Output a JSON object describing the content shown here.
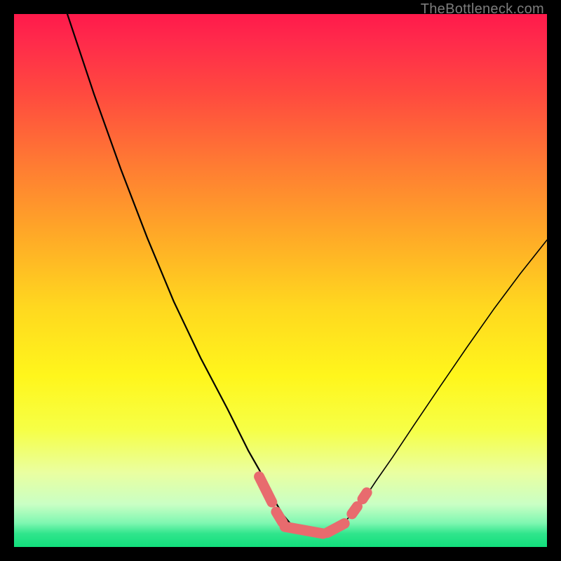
{
  "watermark": "TheBottleneck.com",
  "chart_data": {
    "type": "line",
    "title": "",
    "xlabel": "",
    "ylabel": "",
    "xlim": [
      0,
      100
    ],
    "ylim": [
      0,
      100
    ],
    "grid": false,
    "background_gradient": {
      "stops": [
        {
          "pos": 0.0,
          "color": "#ff1a4b"
        },
        {
          "pos": 0.05,
          "color": "#ff2a4b"
        },
        {
          "pos": 0.15,
          "color": "#ff4a3f"
        },
        {
          "pos": 0.28,
          "color": "#ff7a33"
        },
        {
          "pos": 0.4,
          "color": "#ffa428"
        },
        {
          "pos": 0.55,
          "color": "#ffd81f"
        },
        {
          "pos": 0.68,
          "color": "#fff61c"
        },
        {
          "pos": 0.78,
          "color": "#f6ff46"
        },
        {
          "pos": 0.86,
          "color": "#eaffa0"
        },
        {
          "pos": 0.92,
          "color": "#c9ffc4"
        },
        {
          "pos": 0.955,
          "color": "#7ff7b1"
        },
        {
          "pos": 0.975,
          "color": "#30e58c"
        },
        {
          "pos": 1.0,
          "color": "#12df7c"
        }
      ]
    },
    "series": [
      {
        "name": "left-branch",
        "stroke": "#000000",
        "x": [
          10,
          15,
          20,
          25,
          30,
          35,
          40,
          44,
          46,
          47.5,
          49,
          50.5,
          52,
          53,
          54,
          55
        ],
        "y": [
          100,
          85,
          71,
          58,
          46,
          35.5,
          26,
          18,
          14.5,
          11.5,
          8.5,
          6,
          4.2,
          3.3,
          2.8,
          2.5
        ]
      },
      {
        "name": "right-branch",
        "stroke": "#000000",
        "x": [
          55,
          57,
          59,
          61,
          62.5,
          64,
          66,
          68,
          71,
          75,
          80,
          85,
          90,
          95,
          100
        ],
        "y": [
          2.5,
          2.6,
          3.1,
          4.0,
          5.2,
          6.9,
          9.5,
          12.5,
          16.8,
          22.8,
          30.2,
          37.5,
          44.6,
          51.3,
          57.6
        ]
      },
      {
        "name": "floor-band",
        "stroke": "#000000",
        "x": [
          46,
          65
        ],
        "y": [
          2.4,
          2.4
        ]
      }
    ],
    "markers": [
      {
        "name": "marker-region",
        "shape": "pill",
        "color": "#e86b6e",
        "segments": [
          {
            "x1": 46.0,
            "y1": 13.2,
            "x2": 48.4,
            "y2": 8.4
          },
          {
            "x1": 49.2,
            "y1": 6.6,
            "x2": 50.4,
            "y2": 4.6
          },
          {
            "x1": 50.8,
            "y1": 3.8,
            "x2": 58.0,
            "y2": 2.5
          },
          {
            "x1": 58.8,
            "y1": 2.7,
            "x2": 62.0,
            "y2": 4.4
          },
          {
            "x1": 63.4,
            "y1": 6.2,
            "x2": 64.4,
            "y2": 7.6
          },
          {
            "x1": 65.4,
            "y1": 9.0,
            "x2": 66.2,
            "y2": 10.2
          }
        ]
      }
    ]
  }
}
